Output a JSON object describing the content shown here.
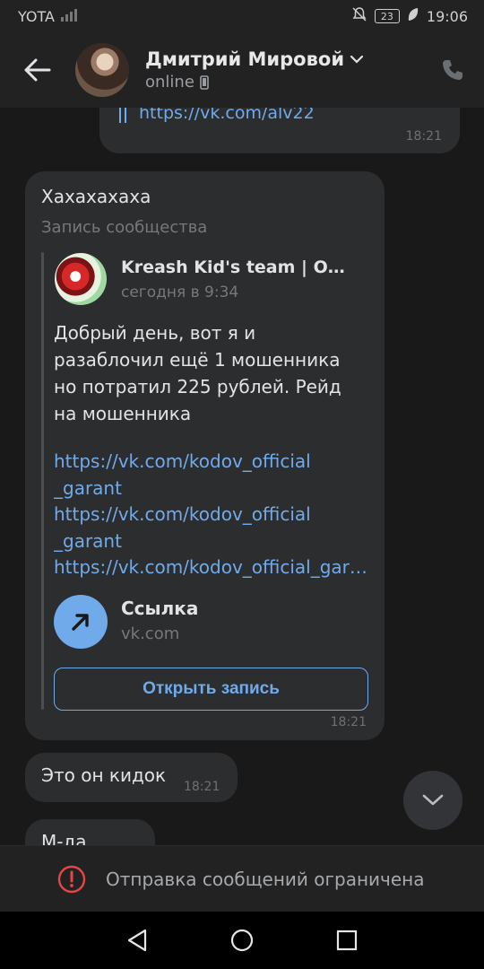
{
  "status_bar": {
    "carrier": "YOTA",
    "battery": "23",
    "time": "19:06"
  },
  "header": {
    "name": "Дмитрий Мировой",
    "status": "online"
  },
  "messages": {
    "outgoing_partial": {
      "link": "https://vk.com/alv22",
      "time": "18:21"
    },
    "post_message": {
      "text": "Хахахахаха",
      "subtitle": "Запись сообщества",
      "group_name": "Kreash Kid's team | Official",
      "group_time": "сегодня в 9:34",
      "body": "Добрый день, вот я и разаблочил ещё 1 мошенника но потратил 225 рублей. Рейд на мошенника",
      "links": [
        "https://vk.com/kodov_official _garant",
        "https://vk.com/kodov_official _garant",
        "https://vk.com/kodov_official_garant"
      ],
      "link_attachment": {
        "title": "Ссылка",
        "domain": "vk.com"
      },
      "open_button": "Открыть запись",
      "time": "18:21"
    },
    "msg2": {
      "text": "Это он кидок",
      "time": "18:21"
    },
    "msg3": {
      "text": "М-да"
    }
  },
  "restricted": {
    "text": "Отправка сообщений ограничена"
  },
  "colors": {
    "accent": "#71aaeb",
    "bubble": "#2c2d2e",
    "background": "#19191a",
    "warning": "#e64646"
  }
}
